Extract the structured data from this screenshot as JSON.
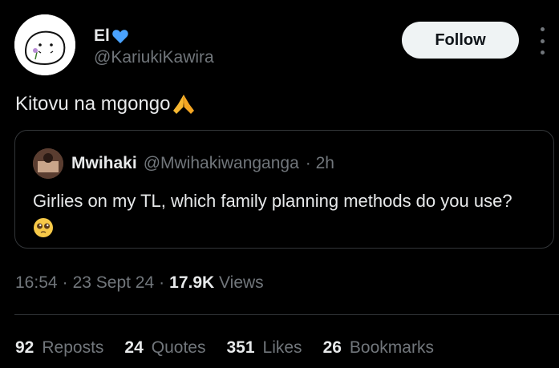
{
  "author": {
    "name": "El",
    "handle": "@KariukiKawira",
    "verified_heart_color": "#4aa3ff"
  },
  "follow_label": "Follow",
  "tweet": {
    "text": "Kitovu na mgongo",
    "emoji": "folded-hands"
  },
  "quote": {
    "name": "Mwihaki",
    "handle": "@Mwihakiwanganga",
    "time": "· 2h",
    "text": "Girlies on my TL, which family planning methods do you use?",
    "emoji": "pleading-face"
  },
  "meta": {
    "time": "16:54",
    "sep1": "·",
    "date": "23 Sept 24",
    "sep2": "·",
    "views_count": "17.9K",
    "views_label": "Views"
  },
  "stats": [
    {
      "count": "92",
      "label": "Reposts"
    },
    {
      "count": "24",
      "label": "Quotes"
    },
    {
      "count": "351",
      "label": "Likes"
    },
    {
      "count": "26",
      "label": "Bookmarks"
    }
  ]
}
